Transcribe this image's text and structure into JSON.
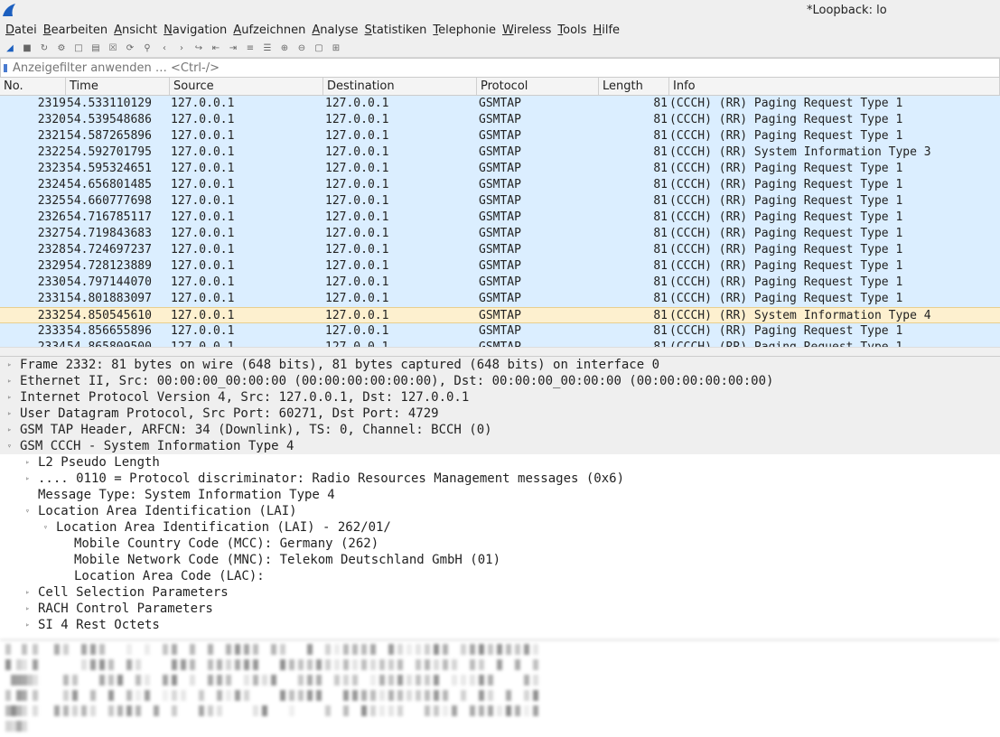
{
  "window": {
    "title": "*Loopback: lo"
  },
  "menu": [
    "Datei",
    "Bearbeiten",
    "Ansicht",
    "Navigation",
    "Aufzeichnen",
    "Analyse",
    "Statistiken",
    "Telephonie",
    "Wireless",
    "Tools",
    "Hilfe"
  ],
  "toolbar_icons": [
    "start-capture-icon",
    "stop-capture-icon",
    "restart-capture-icon",
    "capture-options-icon",
    "open-icon",
    "save-icon",
    "close-file-icon",
    "reload-icon",
    "find-icon",
    "back-icon",
    "forward-icon",
    "goto-icon",
    "first-icon",
    "last-icon",
    "autoscroll-icon",
    "colorize-icon",
    "zoom-in-icon",
    "zoom-out-icon",
    "normal-size-icon",
    "resize-columns-icon"
  ],
  "filter": {
    "placeholder": "Anzeigefilter anwenden … <Ctrl-/>"
  },
  "columns": [
    "No.",
    "Time",
    "Source",
    "Destination",
    "Protocol",
    "Length",
    "Info"
  ],
  "packets": [
    [
      "2319",
      "54.533110129",
      "127.0.0.1",
      "127.0.0.1",
      "GSMTAP",
      "81",
      "(CCCH) (RR) Paging Request Type 1"
    ],
    [
      "2320",
      "54.539548686",
      "127.0.0.1",
      "127.0.0.1",
      "GSMTAP",
      "81",
      "(CCCH) (RR) Paging Request Type 1"
    ],
    [
      "2321",
      "54.587265896",
      "127.0.0.1",
      "127.0.0.1",
      "GSMTAP",
      "81",
      "(CCCH) (RR) Paging Request Type 1"
    ],
    [
      "2322",
      "54.592701795",
      "127.0.0.1",
      "127.0.0.1",
      "GSMTAP",
      "81",
      "(CCCH) (RR) System Information Type 3"
    ],
    [
      "2323",
      "54.595324651",
      "127.0.0.1",
      "127.0.0.1",
      "GSMTAP",
      "81",
      "(CCCH) (RR) Paging Request Type 1"
    ],
    [
      "2324",
      "54.656801485",
      "127.0.0.1",
      "127.0.0.1",
      "GSMTAP",
      "81",
      "(CCCH) (RR) Paging Request Type 1"
    ],
    [
      "2325",
      "54.660777698",
      "127.0.0.1",
      "127.0.0.1",
      "GSMTAP",
      "81",
      "(CCCH) (RR) Paging Request Type 1"
    ],
    [
      "2326",
      "54.716785117",
      "127.0.0.1",
      "127.0.0.1",
      "GSMTAP",
      "81",
      "(CCCH) (RR) Paging Request Type 1"
    ],
    [
      "2327",
      "54.719843683",
      "127.0.0.1",
      "127.0.0.1",
      "GSMTAP",
      "81",
      "(CCCH) (RR) Paging Request Type 1"
    ],
    [
      "2328",
      "54.724697237",
      "127.0.0.1",
      "127.0.0.1",
      "GSMTAP",
      "81",
      "(CCCH) (RR) Paging Request Type 1"
    ],
    [
      "2329",
      "54.728123889",
      "127.0.0.1",
      "127.0.0.1",
      "GSMTAP",
      "81",
      "(CCCH) (RR) Paging Request Type 1"
    ],
    [
      "2330",
      "54.797144070",
      "127.0.0.1",
      "127.0.0.1",
      "GSMTAP",
      "81",
      "(CCCH) (RR) Paging Request Type 1"
    ],
    [
      "2331",
      "54.801883097",
      "127.0.0.1",
      "127.0.0.1",
      "GSMTAP",
      "81",
      "(CCCH) (RR) Paging Request Type 1"
    ],
    [
      "2332",
      "54.850545610",
      "127.0.0.1",
      "127.0.0.1",
      "GSMTAP",
      "81",
      "(CCCH) (RR) System Information Type 4"
    ],
    [
      "2333",
      "54.856655896",
      "127.0.0.1",
      "127.0.0.1",
      "GSMTAP",
      "81",
      "(CCCH) (RR) Paging Request Type 1"
    ],
    [
      "2334",
      "54.865809500",
      "127.0.0.1",
      "127.0.0.1",
      "GSMTAP",
      "81",
      "(CCCH) (RR) Paging Request Type 1"
    ]
  ],
  "selected_packet": "2332",
  "details": [
    {
      "text": "Frame 2332: 81 bytes on wire (648 bits), 81 bytes captured (648 bits) on interface 0",
      "level": 0,
      "state": "collapsed"
    },
    {
      "text": "Ethernet II, Src: 00:00:00_00:00:00 (00:00:00:00:00:00), Dst: 00:00:00_00:00:00 (00:00:00:00:00:00)",
      "level": 0,
      "state": "collapsed"
    },
    {
      "text": "Internet Protocol Version 4, Src: 127.0.0.1, Dst: 127.0.0.1",
      "level": 0,
      "state": "collapsed"
    },
    {
      "text": "User Datagram Protocol, Src Port: 60271, Dst Port: 4729",
      "level": 0,
      "state": "collapsed"
    },
    {
      "text": "GSM TAP Header, ARFCN: 34 (Downlink), TS: 0, Channel: BCCH (0)",
      "level": 0,
      "state": "collapsed"
    },
    {
      "text": "GSM CCCH - System Information Type 4",
      "level": 0,
      "state": "expanded"
    },
    {
      "text": "L2 Pseudo Length",
      "level": 1,
      "state": "collapsed"
    },
    {
      "text": ".... 0110 = Protocol discriminator: Radio Resources Management messages (0x6)",
      "level": 1,
      "state": "collapsed"
    },
    {
      "text": "Message Type: System Information Type 4",
      "level": 1,
      "state": "leaf"
    },
    {
      "text": "Location Area Identification (LAI)",
      "level": 1,
      "state": "expanded"
    },
    {
      "text": "Location Area Identification (LAI) - 262/01/",
      "level": 2,
      "state": "expanded"
    },
    {
      "text": "Mobile Country Code (MCC): Germany (262)",
      "level": 3,
      "state": "leaf"
    },
    {
      "text": "Mobile Network Code (MNC): Telekom Deutschland GmbH (01)",
      "level": 3,
      "state": "leaf"
    },
    {
      "text": "Location Area Code (LAC):",
      "level": 3,
      "state": "leaf"
    },
    {
      "text": "Cell Selection Parameters",
      "level": 1,
      "state": "collapsed"
    },
    {
      "text": "RACH Control Parameters",
      "level": 1,
      "state": "collapsed"
    },
    {
      "text": "SI 4 Rest Octets",
      "level": 1,
      "state": "collapsed"
    }
  ]
}
